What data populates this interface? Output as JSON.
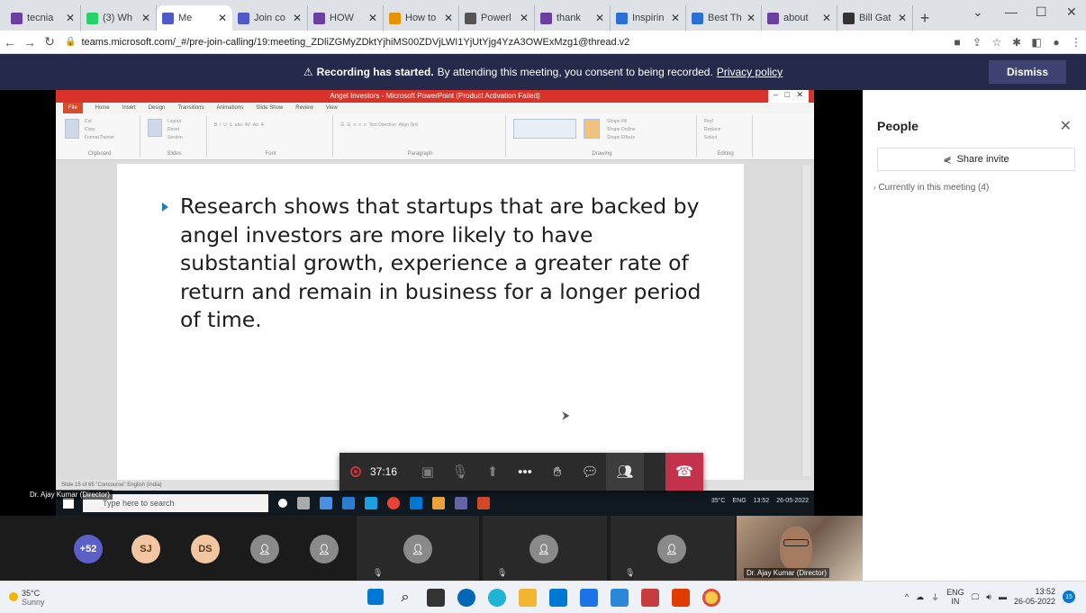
{
  "browser": {
    "tabs": [
      {
        "label": "tecnia",
        "color": "#6b3fa0"
      },
      {
        "label": "(3) Wh",
        "color": "#25d366"
      },
      {
        "label": "Me",
        "color": "#5059c9",
        "active": true
      },
      {
        "label": "Join co",
        "color": "#5059c9"
      },
      {
        "label": "HOW",
        "color": "#6b3fa0"
      },
      {
        "label": "How to",
        "color": "#e69500"
      },
      {
        "label": "Powerl",
        "color": "#555555"
      },
      {
        "label": "thank",
        "color": "#6b3fa0"
      },
      {
        "label": "Inspirin",
        "color": "#2a6fd6"
      },
      {
        "label": "Best Th",
        "color": "#2a6fd6"
      },
      {
        "label": "about",
        "color": "#6b3fa0"
      },
      {
        "label": "Bill Gat",
        "color": "#333333"
      }
    ],
    "new_tab": "+",
    "url": "teams.microsoft.com/_#/pre-join-calling/19:meeting_ZDliZGMyZDktYjhiMS00ZDVjLWI1YjUtYjg4YzA3OWExMzg1@thread.v2"
  },
  "banner": {
    "bold": "Recording has started.",
    "text": "By attending this meeting, you consent to being recorded.",
    "link": "Privacy policy",
    "dismiss": "Dismiss"
  },
  "ppt": {
    "window_title": "Angel Investors - Microsoft PowerPoint (Product Activation Failed)",
    "ribbon_tabs": [
      "File",
      "Home",
      "Insert",
      "Design",
      "Transitions",
      "Animations",
      "Slide Show",
      "Review",
      "View"
    ],
    "ribbon_groups": [
      "Clipboard",
      "Slides",
      "Font",
      "Paragraph",
      "Drawing",
      "Editing"
    ],
    "slide_text": "Research shows that startups that are backed by angel investors are more likely to have substantial growth, experience a greater rate of return and remain in business for a longer period of time.",
    "status": "Slide 15 of 65    \"Concourse\"    English (India)",
    "taskbar_search": "Type here to search",
    "tray": [
      "35°C",
      "ENG",
      "13:52",
      "26-05-2022"
    ]
  },
  "presenter": "Dr. Ajay Kumar (Director)",
  "controls": {
    "timer": "37:16"
  },
  "participants": {
    "overflow": "+52",
    "initials": [
      {
        "text": "SJ",
        "color": "#f2c6a0"
      },
      {
        "text": "DS",
        "color": "#f2c6a0"
      }
    ]
  },
  "video_name": "Dr. Ajay Kumar (Director)",
  "people": {
    "title": "People",
    "share": "Share invite",
    "in_meeting": "Currently in this meeting (4)"
  },
  "taskbar": {
    "temp": "35°C",
    "condition": "Sunny",
    "lang1": "ENG",
    "lang2": "IN",
    "time": "13:52",
    "date": "26-05-2022",
    "notifications": "15"
  }
}
